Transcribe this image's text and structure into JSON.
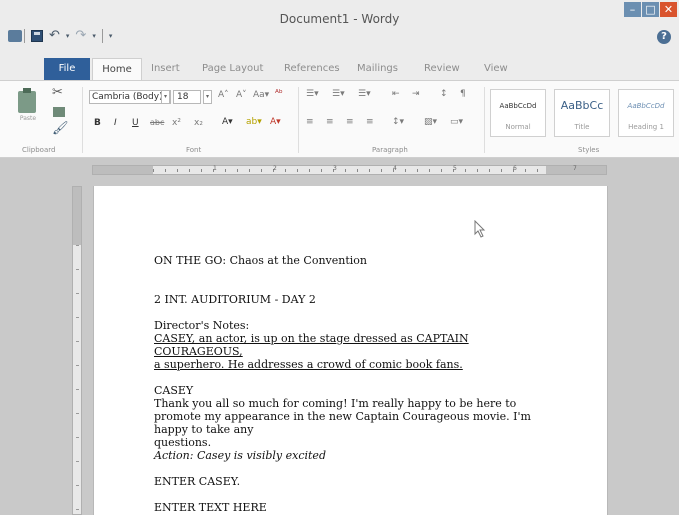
{
  "window": {
    "title": "Document1 - Wordy"
  },
  "quick_access": {
    "save_icon": "save-icon",
    "undo_icon": "undo-icon",
    "redo_icon": "redo-icon"
  },
  "tabs": [
    {
      "label": "File"
    },
    {
      "label": "Home"
    },
    {
      "label": "Insert"
    },
    {
      "label": "Page Layout"
    },
    {
      "label": "References"
    },
    {
      "label": "Mailings"
    },
    {
      "label": "Review"
    },
    {
      "label": "View"
    }
  ],
  "ribbon": {
    "clipboard": {
      "label": "Clipboard",
      "paste_label": "Paste"
    },
    "font": {
      "label": "Font",
      "font_name": "Cambria (Body)",
      "font_size": "18",
      "bold": "B",
      "italic": "I",
      "underline": "U",
      "strike": "abc",
      "superscript": "x²",
      "subscript": "x₂"
    },
    "paragraph": {
      "label": "Paragraph"
    },
    "styles": {
      "label": "Styles",
      "items": [
        {
          "sample": "AaBbCcDd",
          "name": "Normal"
        },
        {
          "sample": "AaBbCc",
          "name": "Title"
        },
        {
          "sample": "AaBbCcDd",
          "name": "Heading 1"
        }
      ]
    }
  },
  "ruler": {
    "numbers": [
      "1",
      "2",
      "3",
      "4",
      "5",
      "6",
      "7"
    ]
  },
  "document": {
    "title_line": "ON THE GO: Chaos at the Convention",
    "scene_heading": "2 INT. AUDITORIUM - DAY 2",
    "notes_label": "Director's Notes:",
    "notes_line1": "CASEY, an actor, is up on the stage dressed as CAPTAIN COURAGEOUS,",
    "notes_line2": "a superhero. He addresses a crowd of comic book fans.",
    "character": "CASEY",
    "dialogue1": "Thank you all so much for coming! I'm really happy to be here to",
    "dialogue2": "promote my appearance in the new Captain Courageous movie. I'm",
    "dialogue3": "happy to take any",
    "dialogue4": "questions.",
    "action": "Action: Casey is visibly excited",
    "enter_casey": "ENTER CASEY.",
    "enter_text": "ENTER TEXT HERE"
  }
}
